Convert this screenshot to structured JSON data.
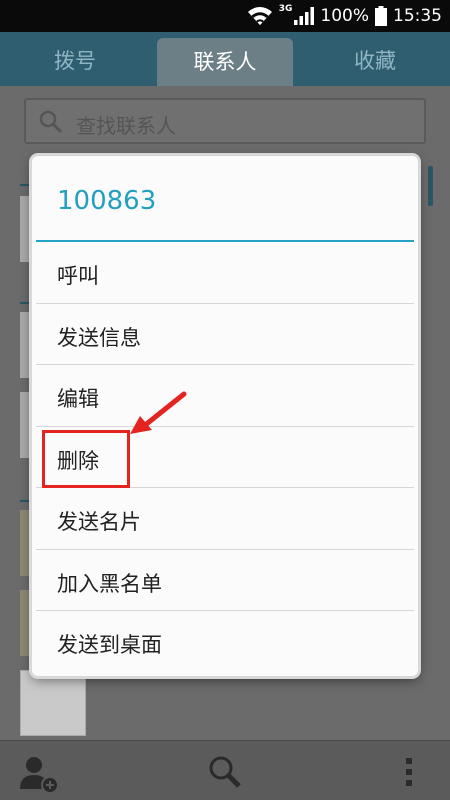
{
  "status_bar": {
    "network_type": "3G",
    "battery_percent": "100%",
    "time": "15:35",
    "icons": [
      "wifi-icon",
      "signal-icon",
      "battery-icon"
    ]
  },
  "tabs": [
    {
      "label": "拨号",
      "active": false
    },
    {
      "label": "联系人",
      "active": true
    },
    {
      "label": "收藏",
      "active": false
    }
  ],
  "search": {
    "placeholder": "查找联系人"
  },
  "dialog": {
    "title": "100863",
    "items": [
      {
        "label": "呼叫"
      },
      {
        "label": "发送信息"
      },
      {
        "label": "编辑"
      },
      {
        "label": "删除",
        "highlighted": true
      },
      {
        "label": "发送名片"
      },
      {
        "label": "加入黑名单"
      },
      {
        "label": "发送到桌面"
      }
    ]
  },
  "bottom_bar": {
    "icons": [
      "add-contact-icon",
      "search-icon",
      "more-icon"
    ]
  },
  "colors": {
    "accent": "#24a3c6",
    "annotation": "#e32421",
    "tab_bar": "#2e5e70"
  }
}
